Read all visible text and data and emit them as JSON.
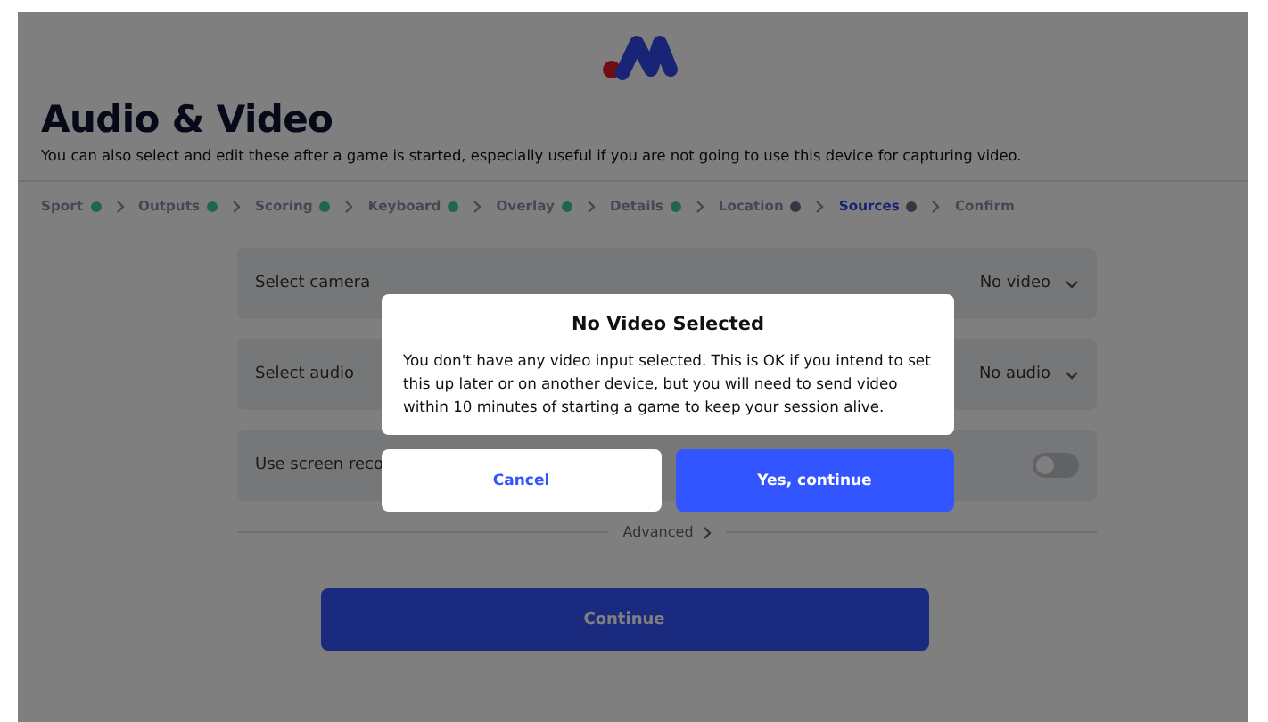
{
  "title": "Audio & Video",
  "subtitle": "You can also select and edit these after a game is started, especially useful if you are not going to use this device for capturing video.",
  "steps": [
    {
      "label": "Sport",
      "complete": true,
      "selected": false
    },
    {
      "label": "Outputs",
      "complete": true,
      "selected": false
    },
    {
      "label": "Scoring",
      "complete": true,
      "selected": false
    },
    {
      "label": "Keyboard",
      "complete": true,
      "selected": false
    },
    {
      "label": "Overlay",
      "complete": true,
      "selected": false
    },
    {
      "label": "Details",
      "complete": true,
      "selected": false
    },
    {
      "label": "Location",
      "complete": false,
      "selected": false
    },
    {
      "label": "Sources",
      "complete": false,
      "selected": true
    },
    {
      "label": "Confirm",
      "selected": false
    }
  ],
  "settings": [
    {
      "kind": "select",
      "label": "Select camera",
      "value": "No video"
    },
    {
      "kind": "select",
      "label": "Select audio",
      "value": "No audio"
    },
    {
      "kind": "toggle",
      "label": "Use screen reco",
      "on": false
    }
  ],
  "advanced": "Advanced",
  "continue": "Continue",
  "dialog": {
    "title": "No Video Selected",
    "message": "You don't have any video input selected. This is OK if you intend to set this up later or on another device, but you will need to send video within 10 minutes of starting a game to keep your session alive.",
    "cancel": "Cancel",
    "confirm": "Yes, continue"
  }
}
